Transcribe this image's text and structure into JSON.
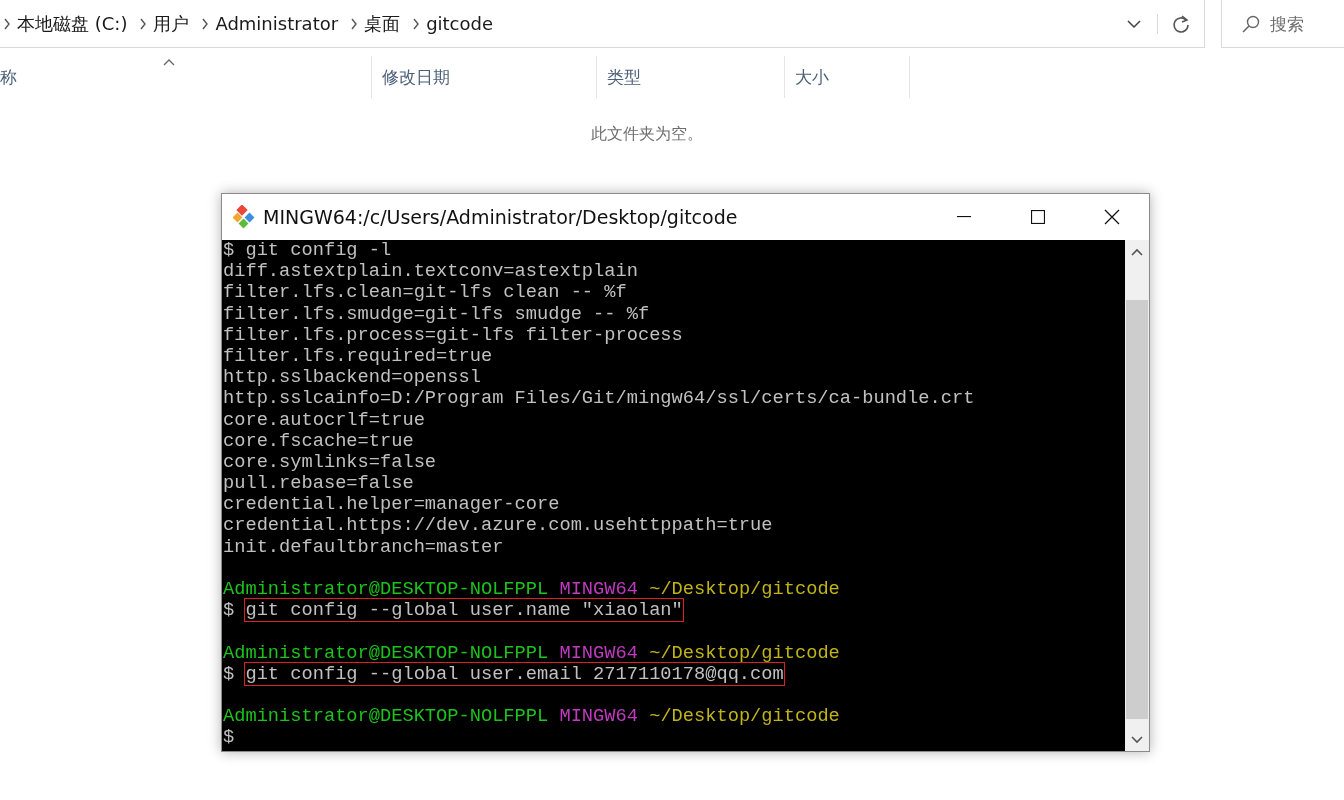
{
  "explorer": {
    "breadcrumb": [
      "本地磁盘 (C:)",
      "用户",
      "Administrator",
      "桌面",
      "gitcode"
    ],
    "search": {
      "placeholder": "搜索"
    },
    "columns": [
      {
        "label": "称",
        "sorted": true
      },
      {
        "label": "修改日期",
        "sorted": false
      },
      {
        "label": "类型",
        "sorted": false
      },
      {
        "label": "大小",
        "sorted": false
      }
    ],
    "empty_message": "此文件夹为空。"
  },
  "terminal": {
    "title": "MINGW64:/c/Users/Administrator/Desktop/gitcode",
    "lines": [
      {
        "kind": "command",
        "sign": "$",
        "command": "git config -l",
        "highlighted": false
      },
      {
        "kind": "output",
        "text": "diff.astextplain.textconv=astextplain"
      },
      {
        "kind": "output",
        "text": "filter.lfs.clean=git-lfs clean -- %f"
      },
      {
        "kind": "output",
        "text": "filter.lfs.smudge=git-lfs smudge -- %f"
      },
      {
        "kind": "output",
        "text": "filter.lfs.process=git-lfs filter-process"
      },
      {
        "kind": "output",
        "text": "filter.lfs.required=true"
      },
      {
        "kind": "output",
        "text": "http.sslbackend=openssl"
      },
      {
        "kind": "output",
        "text": "http.sslcainfo=D:/Program Files/Git/mingw64/ssl/certs/ca-bundle.crt"
      },
      {
        "kind": "output",
        "text": "core.autocrlf=true"
      },
      {
        "kind": "output",
        "text": "core.fscache=true"
      },
      {
        "kind": "output",
        "text": "core.symlinks=false"
      },
      {
        "kind": "output",
        "text": "pull.rebase=false"
      },
      {
        "kind": "output",
        "text": "credential.helper=manager-core"
      },
      {
        "kind": "output",
        "text": "credential.https://dev.azure.com.usehttppath=true"
      },
      {
        "kind": "output",
        "text": "init.defaultbranch=master"
      },
      {
        "kind": "blank"
      },
      {
        "kind": "prompt",
        "user": "Administrator@DESKTOP-NOLFPPL",
        "shell": "MINGW64",
        "path": "~/Desktop/gitcode"
      },
      {
        "kind": "command",
        "sign": "$",
        "command": "git config --global user.name \"xiaolan\"",
        "highlighted": true
      },
      {
        "kind": "blank"
      },
      {
        "kind": "prompt",
        "user": "Administrator@DESKTOP-NOLFPPL",
        "shell": "MINGW64",
        "path": "~/Desktop/gitcode"
      },
      {
        "kind": "command",
        "sign": "$",
        "command": "git config --global user.email 2717110178@qq.com",
        "highlighted": true
      },
      {
        "kind": "blank"
      },
      {
        "kind": "prompt",
        "user": "Administrator@DESKTOP-NOLFPPL",
        "shell": "MINGW64",
        "path": "~/Desktop/gitcode"
      },
      {
        "kind": "command",
        "sign": "$"
      }
    ]
  }
}
